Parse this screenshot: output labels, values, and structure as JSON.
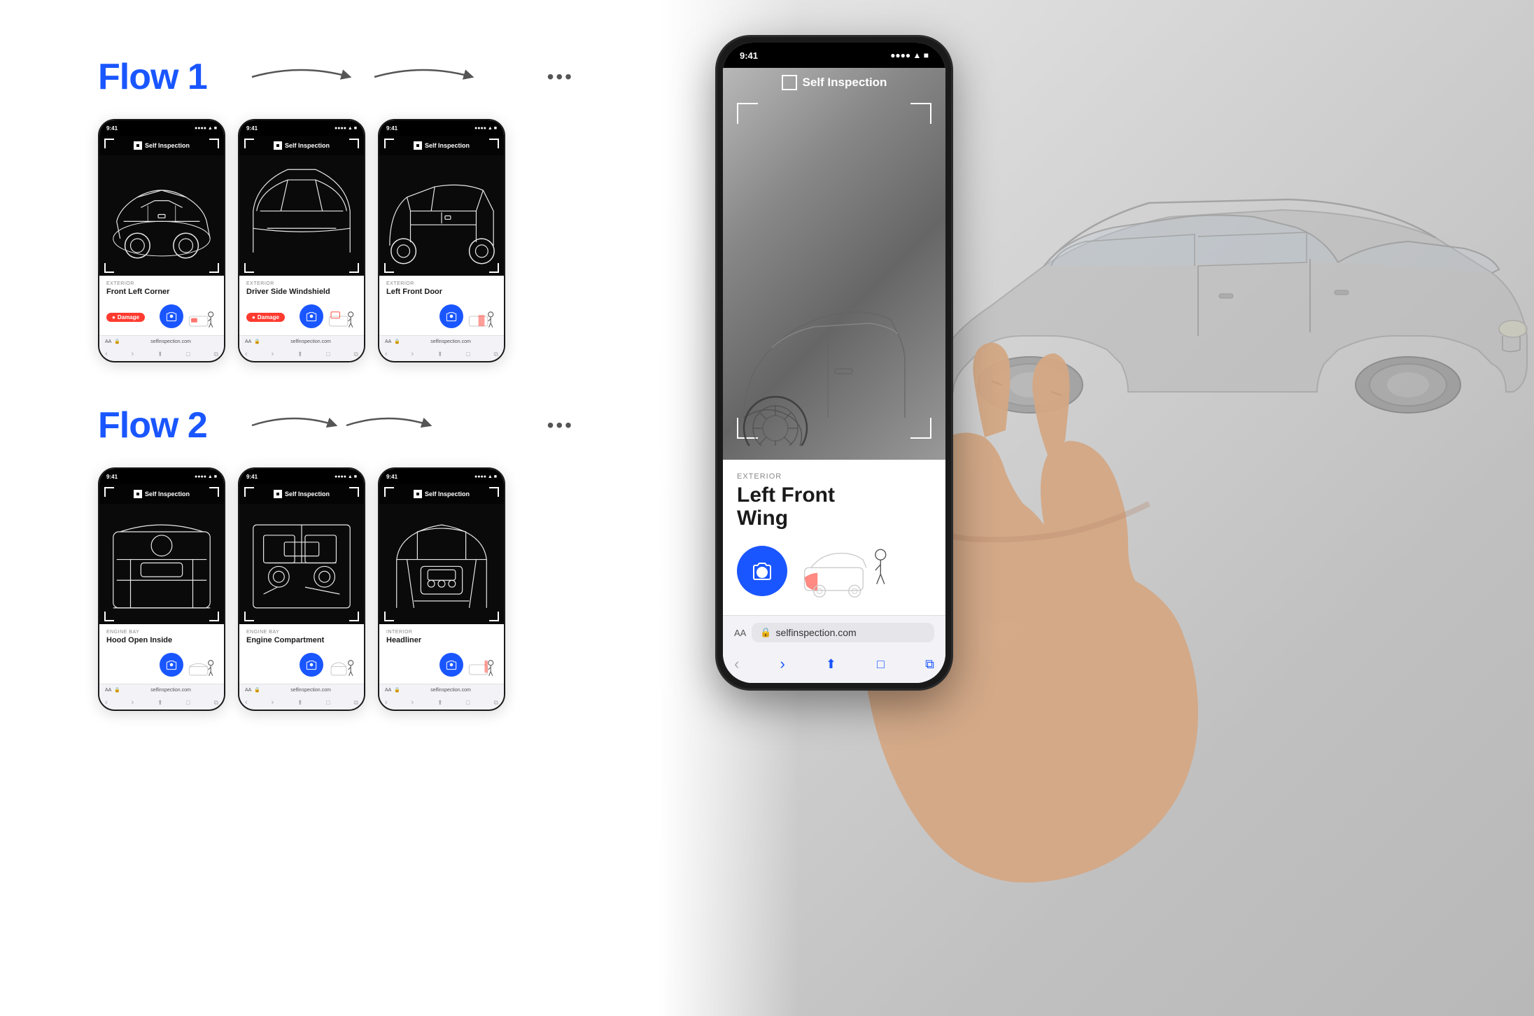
{
  "flows": [
    {
      "id": "flow1",
      "title": "Flow 1",
      "screens": [
        {
          "time": "9:41",
          "area_label": "EXTERIOR",
          "part_name": "Front Left Corner",
          "has_damage": true,
          "damage_label": "Damage"
        },
        {
          "time": "9:41",
          "area_label": "EXTERIOR",
          "part_name": "Driver Side Windshield",
          "has_damage": true,
          "damage_label": "Damage"
        },
        {
          "time": "9:41",
          "area_label": "EXTERIOR",
          "part_name": "Left Front Door",
          "has_damage": false
        }
      ]
    },
    {
      "id": "flow2",
      "title": "Flow 2",
      "screens": [
        {
          "time": "9:41",
          "area_label": "ENGINE BAY",
          "part_name": "Hood Open Inside",
          "has_damage": false
        },
        {
          "time": "9:41",
          "area_label": "ENGINE BAY",
          "part_name": "Engine Compartment",
          "has_damage": false
        },
        {
          "time": "9:41",
          "area_label": "INTERIOR",
          "part_name": "Headliner",
          "has_damage": false
        }
      ]
    }
  ],
  "large_phone": {
    "time": "9:41",
    "signal": "●●●●",
    "wifi": "wifi",
    "battery": "■■■■",
    "header_title": "Self Inspection",
    "area_label": "EXTERIOR",
    "part_name_line1": "Left Front",
    "part_name_line2": "Wing",
    "url": "selfinspection.com",
    "url_icon": "🔒"
  },
  "browser_url": "selfinspection.com",
  "dots_label": "•••"
}
